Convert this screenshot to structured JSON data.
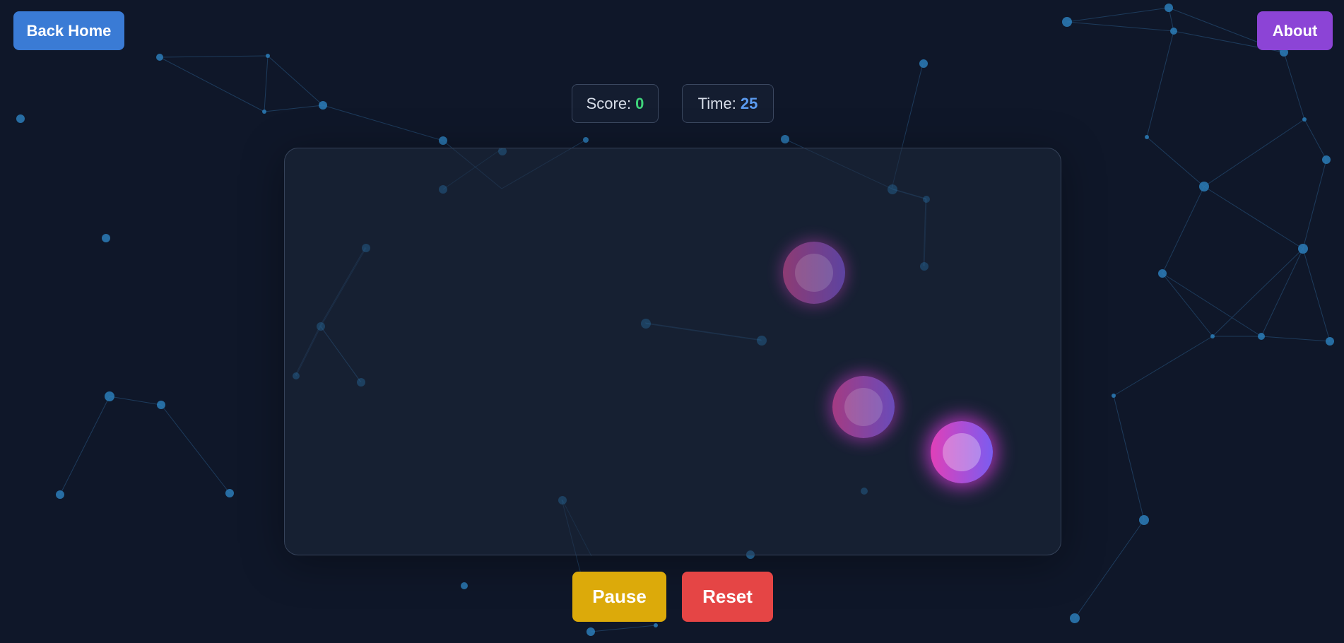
{
  "nav": {
    "back_home_label": "Back Home",
    "about_label": "About"
  },
  "stats": {
    "score_label": "Score:",
    "score_value": "0",
    "time_label": "Time:",
    "time_value": "25"
  },
  "controls": {
    "pause_label": "Pause",
    "reset_label": "Reset"
  },
  "colors": {
    "background": "#0f1729",
    "network_node": "#2f7fb6",
    "back_home_button": "#3a7bd5",
    "about_button": "#8c44d6",
    "pause_button": "#dcaa0a",
    "reset_button": "#e54545",
    "score_value": "#3fd27a",
    "time_value": "#5b9bf0"
  },
  "game": {
    "target_count": 3
  }
}
